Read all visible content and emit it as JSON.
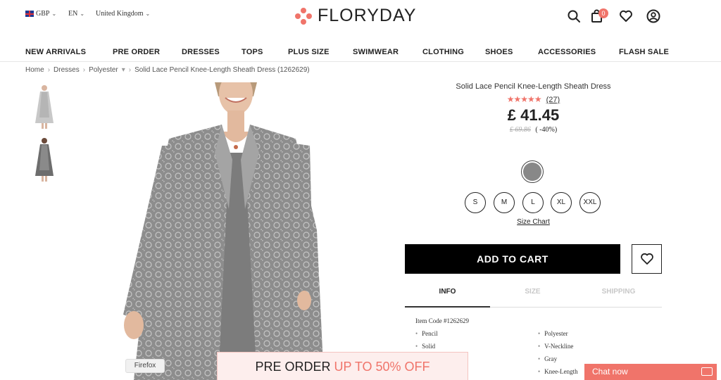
{
  "header": {
    "currency": "GBP",
    "language": "EN",
    "country": "United Kingdom",
    "logo_text": "FLORYDAY",
    "cart_count": "0"
  },
  "nav": [
    "NEW ARRIVALS",
    "PRE ORDER",
    "DRESSES",
    "TOPS",
    "PLUS SIZE",
    "SWIMWEAR",
    "CLOTHING",
    "SHOES",
    "ACCESSORIES",
    "FLASH SALE"
  ],
  "breadcrumb": [
    "Home",
    "Dresses",
    "Polyester",
    "Solid Lace Pencil Knee-Length Sheath Dress (1262629)"
  ],
  "product": {
    "title": "Solid Lace Pencil Knee-Length Sheath Dress",
    "stars": "★★★★★",
    "rating": 5,
    "review_count": "(27)",
    "price": "£ 41.45",
    "old_price": "£ 69.86",
    "discount": "( -40%)",
    "color": "#888888",
    "sizes": [
      "S",
      "M",
      "L",
      "XL",
      "XXL"
    ],
    "size_chart": "Size Chart",
    "add_to_cart": "ADD TO CART"
  },
  "tabs": [
    "INFO",
    "SIZE",
    "SHIPPING"
  ],
  "info": {
    "item_code": "Item Code #1262629",
    "left": [
      "Pencil",
      "Solid"
    ],
    "right": [
      "Polyester",
      "V-Neckline",
      "Gray",
      "Knee-Length"
    ]
  },
  "browser_tooltip": "Firefox",
  "promo": {
    "part1": "PRE ORDER",
    "part2": "UP TO 50% OFF"
  },
  "chat": {
    "label": "Chat now"
  },
  "colors": {
    "accent": "#f0746a",
    "swatch_gray": "#888888"
  }
}
